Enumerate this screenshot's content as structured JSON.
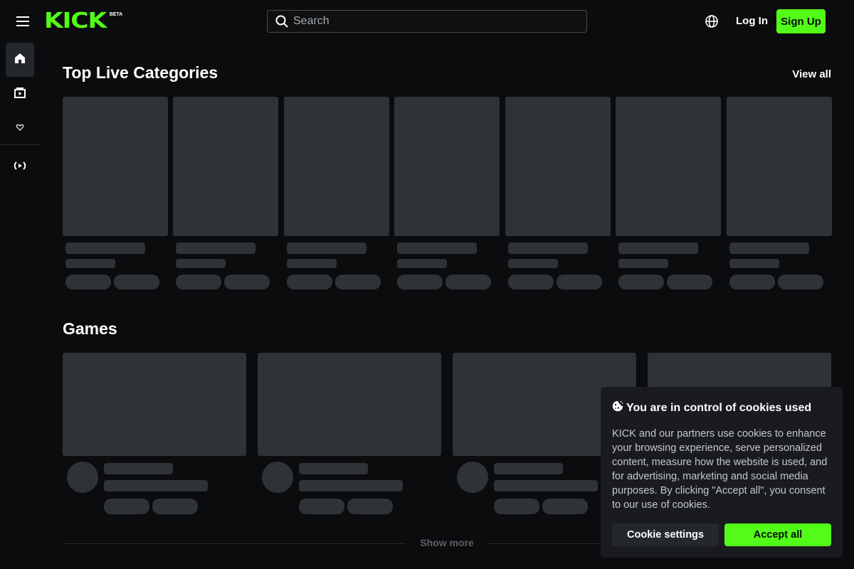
{
  "header": {
    "logo_text": "KICK",
    "logo_badge": "BETA",
    "search_placeholder": "Search",
    "login_label": "Log In",
    "signup_label": "Sign Up"
  },
  "sidebar": {
    "items": [
      {
        "icon": "home-icon",
        "active": true
      },
      {
        "icon": "browse-icon",
        "active": false
      },
      {
        "icon": "following-heart-icon",
        "active": false
      },
      {
        "icon": "live-broadcast-icon",
        "active": false
      }
    ]
  },
  "sections": {
    "top_live_categories": {
      "title": "Top Live Categories",
      "view_all_label": "View all"
    },
    "games": {
      "title": "Games",
      "show_more_label": "Show more"
    }
  },
  "cookie_banner": {
    "title": "You are in control of cookies used",
    "body": "KICK and our partners use cookies to enhance your browsing experience, serve personalized content, measure how the website is used, and for advertising, marketing and social media purposes. By clicking \"Accept all\", you consent to our use of cookies.",
    "settings_label": "Cookie settings",
    "accept_label": "Accept all"
  },
  "colors": {
    "brand": "#53fc18",
    "background": "#0b0c0d",
    "skeleton": "#2f3237",
    "dialog": "#191b1f"
  }
}
